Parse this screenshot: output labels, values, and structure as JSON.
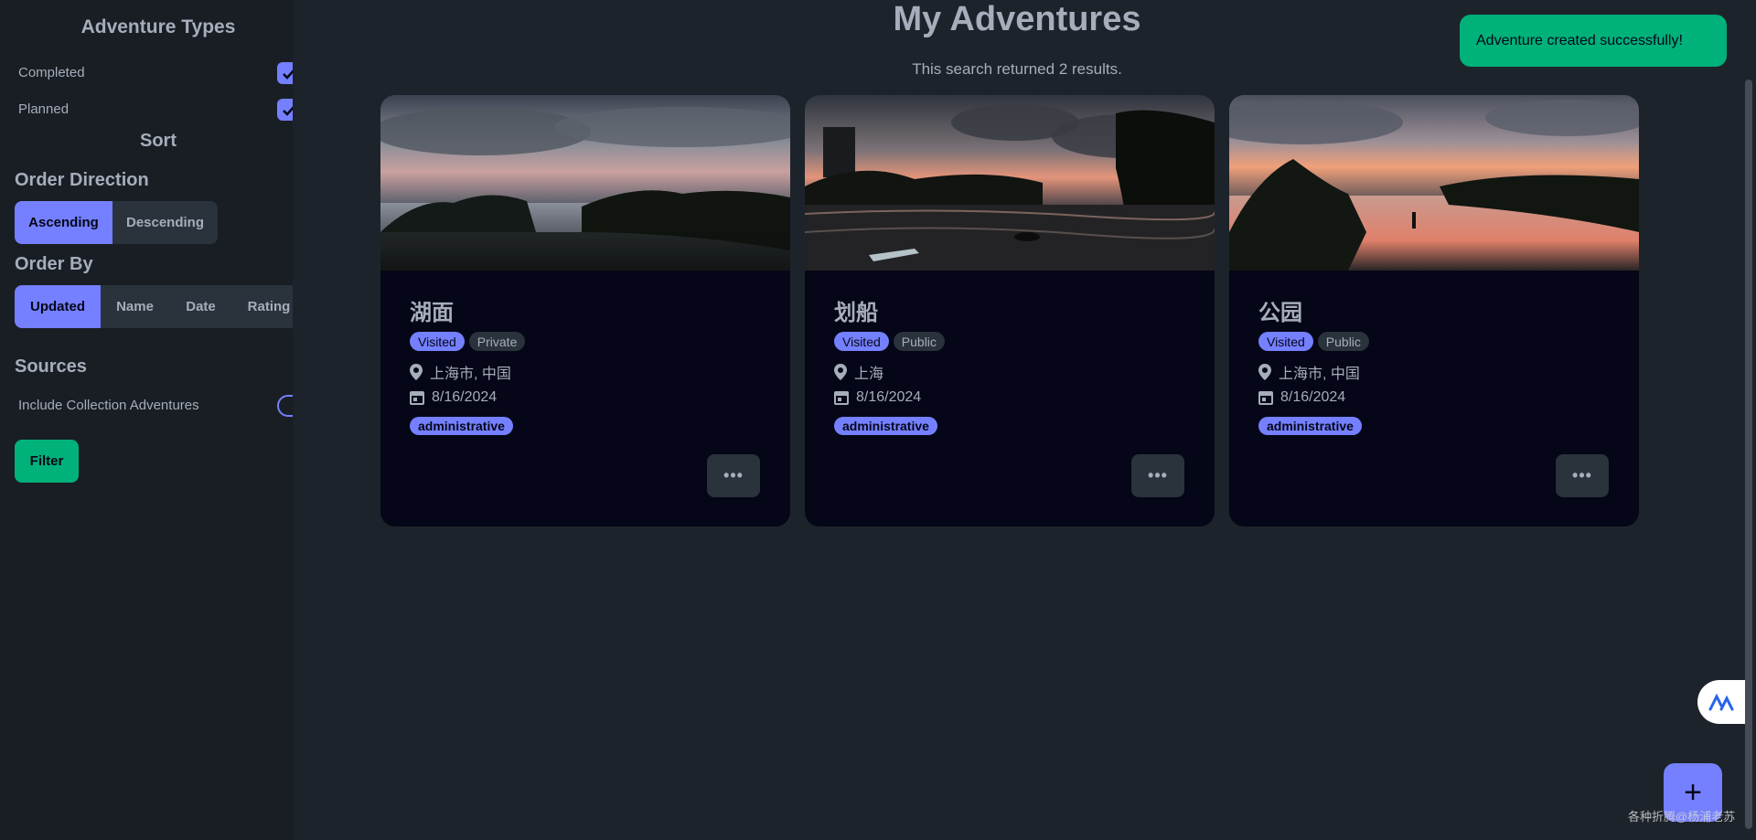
{
  "sidebar": {
    "adventure_types_title": "Adventure Types",
    "completed_label": "Completed",
    "planned_label": "Planned",
    "sort_title": "Sort",
    "order_direction_heading": "Order Direction",
    "order_direction_options": [
      "Ascending",
      "Descending"
    ],
    "order_direction_selected": "Ascending",
    "order_by_heading": "Order By",
    "order_by_options": [
      "Updated",
      "Name",
      "Date",
      "Rating"
    ],
    "order_by_selected": "Updated",
    "sources_heading": "Sources",
    "include_collection_label": "Include Collection Adventures",
    "filter_label": "Filter"
  },
  "main": {
    "title": "My Adventures",
    "result_text": "This search returned 2 results."
  },
  "cards": [
    {
      "name": "湖面",
      "status": "Visited",
      "visibility": "Private",
      "location": "上海市, 中国",
      "date": "8/16/2024",
      "tag": "administrative",
      "more": "•••"
    },
    {
      "name": "划船",
      "status": "Visited",
      "visibility": "Public",
      "location": "上海",
      "date": "8/16/2024",
      "tag": "administrative",
      "more": "•••"
    },
    {
      "name": "公园",
      "status": "Visited",
      "visibility": "Public",
      "location": "上海市, 中国",
      "date": "8/16/2024",
      "tag": "administrative",
      "more": "•••"
    }
  ],
  "toast": {
    "message": "Adventure created successfully!"
  },
  "fab": {
    "label": "+"
  },
  "watermark": "各种折腾@杨浦老苏",
  "colors": {
    "primary": "#7480ff",
    "success": "#00b17a",
    "card_bg": "#050617",
    "page_bg": "#1d232a"
  }
}
